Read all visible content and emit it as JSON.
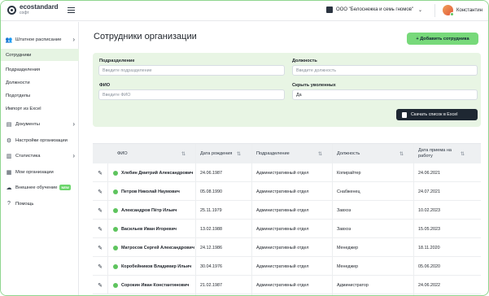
{
  "header": {
    "logo_name": "ecostandard",
    "logo_sub": "софт",
    "org_name": "ООО \"Белоснежка и семь гномов\"",
    "user_name": "Константин"
  },
  "sidebar": {
    "items": [
      {
        "label": "Штатное расписание",
        "icon": "users-icon",
        "chevron": "›"
      },
      {
        "label": "Сотрудники"
      },
      {
        "label": "Подразделения"
      },
      {
        "label": "Должности"
      },
      {
        "label": "Подотделы"
      },
      {
        "label": "Импорт из Excel"
      },
      {
        "label": "Документы",
        "icon": "document-icon",
        "chevron": "›"
      },
      {
        "label": "Настройки организации",
        "icon": "gear-icon"
      },
      {
        "label": "Статистика",
        "icon": "chart-icon",
        "chevron": "›"
      },
      {
        "label": "Мои организации",
        "icon": "building-icon"
      },
      {
        "label": "Внешнее обучение",
        "icon": "cloud-icon",
        "badge": "NEW"
      },
      {
        "label": "Помощь",
        "icon": "help-icon"
      }
    ]
  },
  "main": {
    "title": "Сотрудники организации",
    "add_button": "+ Добавить сотрудника",
    "download_button": "Скачать список в Excel",
    "filters": {
      "department_label": "Подразделение",
      "department_placeholder": "Введите подразделение",
      "position_label": "Должность",
      "position_placeholder": "Введите должность",
      "fio_label": "ФИО",
      "fio_placeholder": "Введите ФИО",
      "hide_fired_label": "Скрыть уволенных",
      "hide_fired_value": "Да"
    }
  },
  "table": {
    "columns": [
      "ФИО",
      "Дата рождения",
      "Подразделение",
      "Должность",
      "Дата приема на работу"
    ],
    "rows": [
      {
        "fio": "Хлебин Дмитрий Александрович",
        "birth": "24.06.1987",
        "dept": "Административный отдел",
        "position": "Копирайтер",
        "hired": "24.06.2021"
      },
      {
        "fio": "Петров Николай Наумович",
        "birth": "05.08.1990",
        "dept": "Административный отдел",
        "position": "Снабженец",
        "hired": "24.07.2021"
      },
      {
        "fio": "Александров Пётр Ильич",
        "birth": "25.11.1979",
        "dept": "Административный отдел",
        "position": "Завхоз",
        "hired": "10.02.2023"
      },
      {
        "fio": "Васильев Иван Игоревич",
        "birth": "13.02.1988",
        "dept": "Административный отдел",
        "position": "Завхоз",
        "hired": "15.05.2023"
      },
      {
        "fio": "Матросов Сергей Александрович",
        "birth": "24.12.1986",
        "dept": "Административный отдел",
        "position": "Менеджер",
        "hired": "18.11.2020"
      },
      {
        "fio": "Коробейников Владимир Ильич",
        "birth": "30.04.1976",
        "dept": "Административный отдел",
        "position": "Менеджер",
        "hired": "05.06.2020"
      },
      {
        "fio": "Сорокин Иван Константинович",
        "birth": "21.02.1987",
        "dept": "Административный отдел",
        "position": "Администратор",
        "hired": "24.06.2022"
      }
    ]
  },
  "colors": {
    "accent": "#77d97a",
    "panel": "#e8f5e4",
    "dark_button": "#1e2732"
  }
}
